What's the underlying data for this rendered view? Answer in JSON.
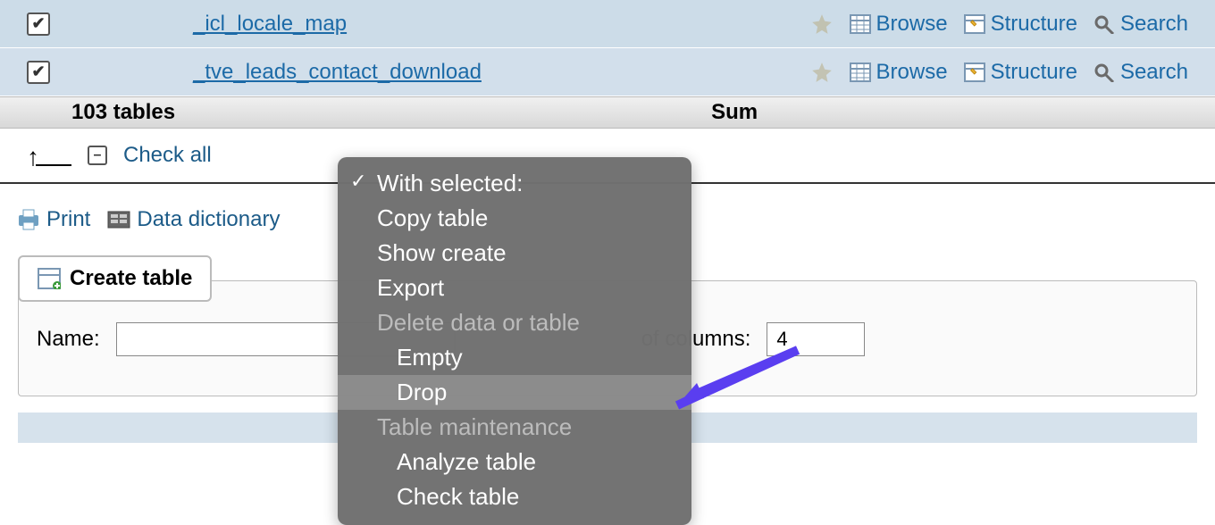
{
  "rows": [
    {
      "name": "_icl_locale_map"
    },
    {
      "name": "_tve_leads_contact_download"
    }
  ],
  "actions": {
    "browse": "Browse",
    "structure": "Structure",
    "search": "Search"
  },
  "summary": {
    "count": "103 tables",
    "sum": "Sum"
  },
  "checkall": {
    "label": "Check all"
  },
  "links": {
    "print": "Print",
    "dictionary": "Data dictionary"
  },
  "create": {
    "button": "Create table",
    "name_label": "Name:",
    "name_value": "",
    "cols_label": "of columns:",
    "cols_value": "4"
  },
  "dropdown": {
    "header": "With selected:",
    "copy": "Copy table",
    "show_create": "Show create",
    "export": "Export",
    "group_delete": "Delete data or table",
    "empty": "Empty",
    "drop": "Drop",
    "group_maint": "Table maintenance",
    "analyze": "Analyze table",
    "check_tbl": "Check table"
  }
}
